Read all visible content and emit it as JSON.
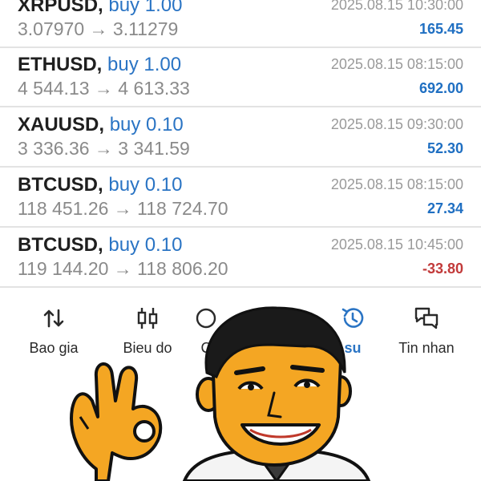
{
  "trades": [
    {
      "symbol": "XRPUSD,",
      "side": "buy 1.00",
      "prices": "3.07970 → 3.11279",
      "time": "2025.08.15 10:30:00",
      "profit": "165.45",
      "profit_sign": "pos"
    },
    {
      "symbol": "ETHUSD,",
      "side": "buy 1.00",
      "prices": "4 544.13 → 4 613.33",
      "time": "2025.08.15 08:15:00",
      "profit": "692.00",
      "profit_sign": "pos"
    },
    {
      "symbol": "XAUUSD,",
      "side": "buy 0.10",
      "prices": "3 336.36 → 3 341.59",
      "time": "2025.08.15 09:30:00",
      "profit": "52.30",
      "profit_sign": "pos"
    },
    {
      "symbol": "BTCUSD,",
      "side": "buy 0.10",
      "prices": "118 451.26 → 118 724.70",
      "time": "2025.08.15 08:15:00",
      "profit": "27.34",
      "profit_sign": "pos"
    },
    {
      "symbol": "BTCUSD,",
      "side": "buy 0.10",
      "prices": "119 144.20 → 118 806.20",
      "time": "2025.08.15 10:45:00",
      "profit": "-33.80",
      "profit_sign": "neg"
    }
  ],
  "nav": {
    "items": [
      {
        "label": "Bao gia",
        "icon": "sort-arrows-icon"
      },
      {
        "label": "Bieu do",
        "icon": "candlestick-icon"
      },
      {
        "label": "C",
        "icon": "trade-icon"
      },
      {
        "label": "su",
        "icon": "history-icon",
        "active": true
      },
      {
        "label": "Tin nhan",
        "icon": "chat-icon"
      }
    ]
  },
  "colors": {
    "accent": "#2a74c4",
    "profit_positive": "#1f6fc2",
    "profit_negative": "#c23a3a",
    "divider": "#e3e3e3",
    "muted_text": "#8a8a8a"
  },
  "overlay": {
    "icon": "thumbs-ok-man-sticker-icon"
  }
}
